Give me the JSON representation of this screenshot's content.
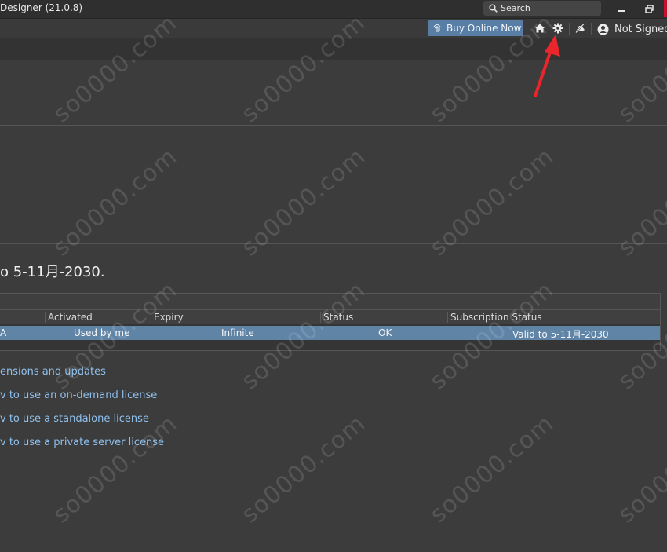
{
  "window": {
    "title": "Designer (21.0.8)",
    "search_placeholder": "Search"
  },
  "toolbar": {
    "buy_label": "Buy Online Now",
    "user_label": "Not Signed"
  },
  "license": {
    "expiry_heading": "o 5-11月-2030.",
    "columns": [
      "Activated",
      "Expiry",
      "Status",
      "Subscription Status"
    ],
    "row": {
      "name": "A",
      "activated": "Used by me",
      "expiry": "Infinite",
      "status": "OK",
      "subscription_status": "Valid to 5-11月-2030"
    }
  },
  "links": [
    "ensions and updates",
    "v to use an on-demand license",
    "v to use a standalone license",
    "v to use a private server license"
  ],
  "watermark": "so0000.com",
  "colors": {
    "accent": "#587ea6",
    "selected_row": "#5f84a6",
    "link": "#8fc0ee",
    "annotation_arrow": "#e8262b"
  }
}
